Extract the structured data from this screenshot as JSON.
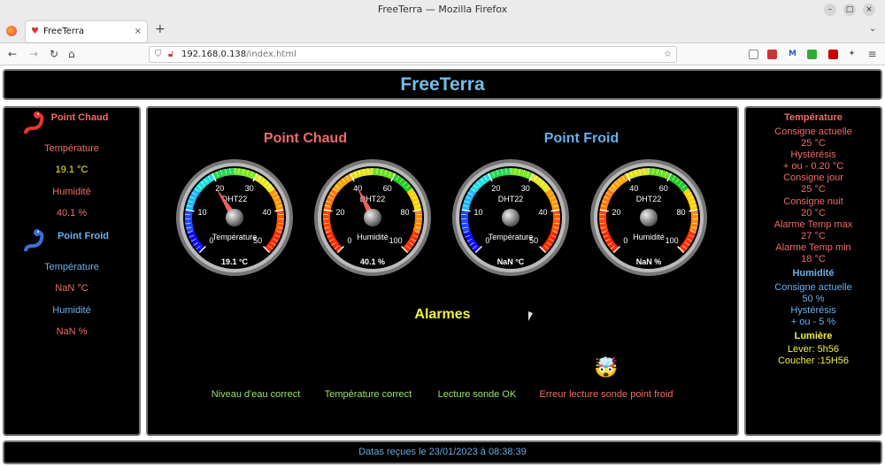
{
  "browser": {
    "window_title": "FreeTerra — Mozilla Firefox",
    "tab_title": "FreeTerra",
    "url_host": "192.168.0.138",
    "url_path": "/index.html"
  },
  "page": {
    "title": "FreeTerra",
    "footer": "Datas reçues le 23/01/2023 à 08:38:39"
  },
  "left": {
    "hot_title": "Point Chaud",
    "hot_temp_label": "Température",
    "hot_temp_value": "19.1 °C",
    "hot_hum_label": "Humidité",
    "hot_hum_value": "40.1 %",
    "cold_title": "Point Froid",
    "cold_temp_label": "Température",
    "cold_temp_value": "NaN °C",
    "cold_hum_label": "Humidité",
    "cold_hum_value": "NaN %"
  },
  "center": {
    "hot_title": "Point Chaud",
    "cold_title": "Point Froid",
    "alarms_title": "Alarmes",
    "gauges": [
      {
        "sensor": "DHT22",
        "label": "Température",
        "value": 19.1,
        "readout": "19.1 °C",
        "min": 0,
        "max": 50,
        "ticks": [
          "0",
          "10",
          "20",
          "30",
          "40",
          "50"
        ],
        "type": "temp"
      },
      {
        "sensor": "DHT22",
        "label": "Humidité",
        "value": 40.1,
        "readout": "40.1 %",
        "min": 0,
        "max": 100,
        "ticks": [
          "0",
          "20",
          "40",
          "60",
          "80",
          "100"
        ],
        "type": "hum"
      },
      {
        "sensor": "DHT22",
        "label": "Température",
        "value": null,
        "readout": "NaN °C",
        "min": 0,
        "max": 50,
        "ticks": [
          "0",
          "10",
          "20",
          "30",
          "40",
          "50"
        ],
        "type": "temp"
      },
      {
        "sensor": "DHT22",
        "label": "Humidité",
        "value": null,
        "readout": "NaN %",
        "min": 0,
        "max": 100,
        "ticks": [
          "0",
          "20",
          "40",
          "60",
          "80",
          "100"
        ],
        "type": "hum"
      }
    ],
    "alarms": [
      {
        "icon": "😎",
        "icon_name": "sunglasses-emoji-icon",
        "label": "Niveau d'eau correct",
        "color": "#9be46a"
      },
      {
        "icon": "😎",
        "icon_name": "sunglasses-emoji-icon",
        "label": "Température correct",
        "color": "#9be46a"
      },
      {
        "icon": "😎",
        "icon_name": "sunglasses-emoji-icon",
        "label": "Lecture sonde OK",
        "color": "#9be46a"
      },
      {
        "icon": "🤯",
        "icon_name": "exploding-head-emoji-icon",
        "label": "Erreur lecture sonde point froid",
        "color": "#f06b6b"
      }
    ]
  },
  "right": {
    "temp_title": "Température",
    "rows": [
      "Consigne actuelle",
      "25 °C",
      "Hystérésis",
      "+ ou - 0.20 °C",
      "Consigne jour",
      "25 °C",
      "Consigne nuit",
      "20 °C",
      "Alarme Temp max",
      "27 °C",
      "Alarme Temp min",
      "18 °C"
    ],
    "hum_title": "Humidité",
    "hum_rows": [
      "Consigne actuelle",
      "50 %",
      "Hystérésis",
      "+ ou - 5 %"
    ],
    "light_title": "Lumière",
    "light_rows": [
      "Lever: 5h56",
      "Coucher :15H56"
    ]
  },
  "colors": {
    "red": "#f06b6b",
    "blue": "#6ab0ec",
    "yellow": "#f2f23c",
    "green": "#9be46a",
    "title": "#72bde6"
  }
}
